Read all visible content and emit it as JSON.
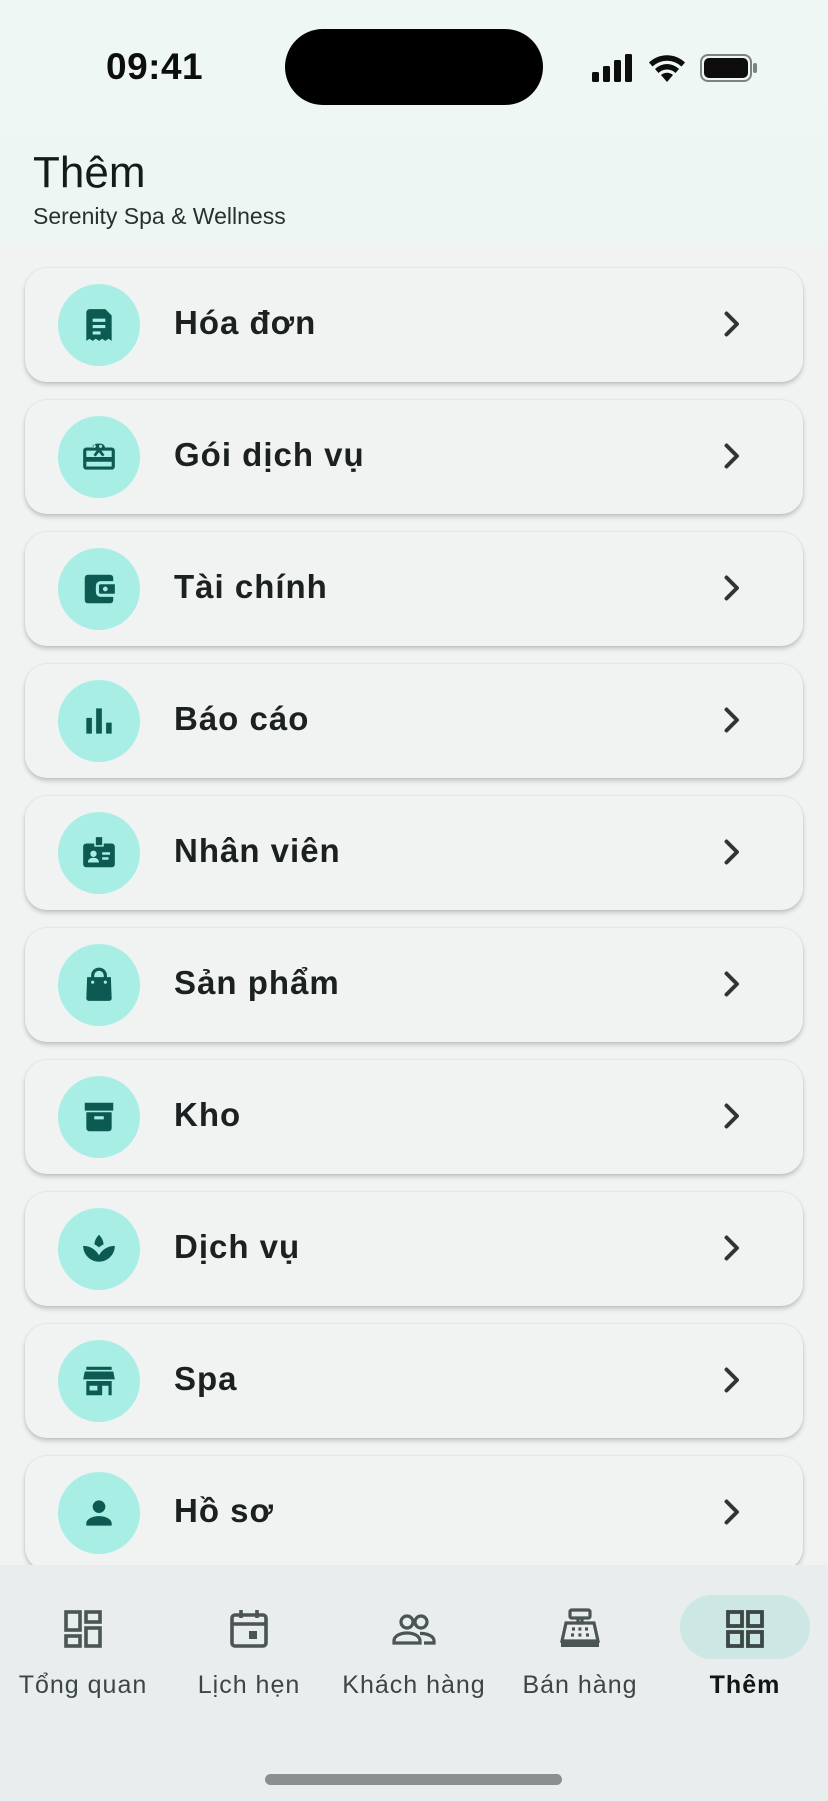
{
  "status_bar": {
    "time": "09:41"
  },
  "header": {
    "title": "Thêm",
    "subtitle": "Serenity Spa & Wellness"
  },
  "menu": [
    {
      "label": "Hóa đơn",
      "icon": "receipt-icon"
    },
    {
      "label": "Gói dịch vụ",
      "icon": "gift-card-icon"
    },
    {
      "label": "Tài chính",
      "icon": "wallet-icon"
    },
    {
      "label": "Báo cáo",
      "icon": "bar-chart-icon"
    },
    {
      "label": "Nhân viên",
      "icon": "badge-icon"
    },
    {
      "label": "Sản phẩm",
      "icon": "shopping-bag-icon"
    },
    {
      "label": "Kho",
      "icon": "archive-box-icon"
    },
    {
      "label": "Dịch vụ",
      "icon": "spa-lotus-icon"
    },
    {
      "label": "Spa",
      "icon": "storefront-icon"
    },
    {
      "label": "Hồ sơ",
      "icon": "person-icon"
    }
  ],
  "bottom_nav": [
    {
      "label": "Tổng quan",
      "icon": "dashboard-icon",
      "active": false
    },
    {
      "label": "Lịch hẹn",
      "icon": "calendar-icon",
      "active": false
    },
    {
      "label": "Khách hàng",
      "icon": "people-icon",
      "active": false
    },
    {
      "label": "Bán hàng",
      "icon": "cash-register-icon",
      "active": false
    },
    {
      "label": "Thêm",
      "icon": "grid-icon",
      "active": true
    }
  ],
  "colors": {
    "accent_circle": "#a9eee5",
    "icon_dark": "#0d5a52",
    "active_pill": "#cde8e4"
  }
}
